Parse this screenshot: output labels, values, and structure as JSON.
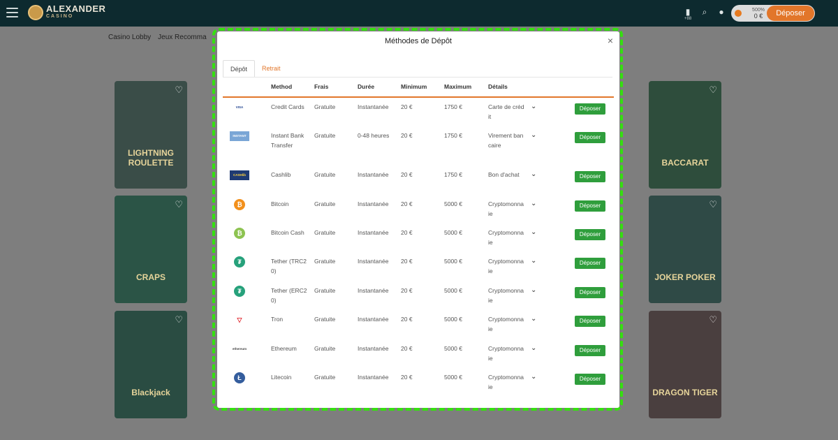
{
  "header": {
    "logo_text": "ALEXANDER",
    "logo_sub": "CASINO",
    "icon_sub": "+88",
    "balance_label": "500%",
    "balance_amount": "0 €",
    "deposit_button": "Déposer"
  },
  "breadcrumbs": [
    "Casino Lobby",
    "Jeux Recomma"
  ],
  "tiles": [
    {
      "title": "LIGHTNING ROULETTE"
    },
    {
      "title": "BACCARAT"
    },
    {
      "title": "CRAPS"
    },
    {
      "title": "JOKER POKER"
    },
    {
      "title": "Blackjack"
    },
    {
      "title": "DRAGON TIGER"
    }
  ],
  "modal": {
    "title": "Méthodes de Dépôt",
    "close": "×",
    "tabs": [
      "Dépôt",
      "Retrait"
    ],
    "columns": [
      "Method",
      "Frais",
      "Durée",
      "Minimum",
      "Maximum",
      "Détails"
    ],
    "deposit_label": "Déposer",
    "rows": [
      {
        "logo": "VISA",
        "method": "Credit Cards",
        "fee": "Gratuite",
        "duration": "Instantanée",
        "min": "20 €",
        "max": "1750 €",
        "details": "Carte de crédit"
      },
      {
        "logo": "INSTANT BANKING",
        "method": "Instant Bank Transfer",
        "fee": "Gratuite",
        "duration": "0-48 heures",
        "min": "20 €",
        "max": "1750 €",
        "details": "Virement bancaire"
      },
      {
        "logo": "CASHlib",
        "method": "Cashlib",
        "fee": "Gratuite",
        "duration": "Instantanée",
        "min": "20 €",
        "max": "1750 €",
        "details": "Bon d'achat"
      },
      {
        "logo": "₿",
        "method": "Bitcoin",
        "fee": "Gratuite",
        "duration": "Instantanée",
        "min": "20 €",
        "max": "5000 €",
        "details": "Cryptomonnaie"
      },
      {
        "logo": "₿",
        "method": "Bitcoin Cash",
        "fee": "Gratuite",
        "duration": "Instantanée",
        "min": "20 €",
        "max": "5000 €",
        "details": "Cryptomonnaie"
      },
      {
        "logo": "₮",
        "method": "Tether (TRC20)",
        "fee": "Gratuite",
        "duration": "Instantanée",
        "min": "20 €",
        "max": "5000 €",
        "details": "Cryptomonnaie"
      },
      {
        "logo": "₮",
        "method": "Tether (ERC20)",
        "fee": "Gratuite",
        "duration": "Instantanée",
        "min": "20 €",
        "max": "5000 €",
        "details": "Cryptomonnaie"
      },
      {
        "logo": "▽",
        "method": "Tron",
        "fee": "Gratuite",
        "duration": "Instantanée",
        "min": "20 €",
        "max": "5000 €",
        "details": "Cryptomonnaie"
      },
      {
        "logo": "ethereum",
        "method": "Ethereum",
        "fee": "Gratuite",
        "duration": "Instantanée",
        "min": "20 €",
        "max": "5000 €",
        "details": "Cryptomonnaie"
      },
      {
        "logo": "Ł",
        "method": "Litecoin",
        "fee": "Gratuite",
        "duration": "Instantanée",
        "min": "20 €",
        "max": "5000 €",
        "details": "Cryptomonnaie"
      }
    ]
  },
  "colors": {
    "accent": "#e2762a",
    "deposit_green": "#2f9e3c",
    "highlight": "#35e010",
    "header_bg": "#0d2a2f"
  }
}
